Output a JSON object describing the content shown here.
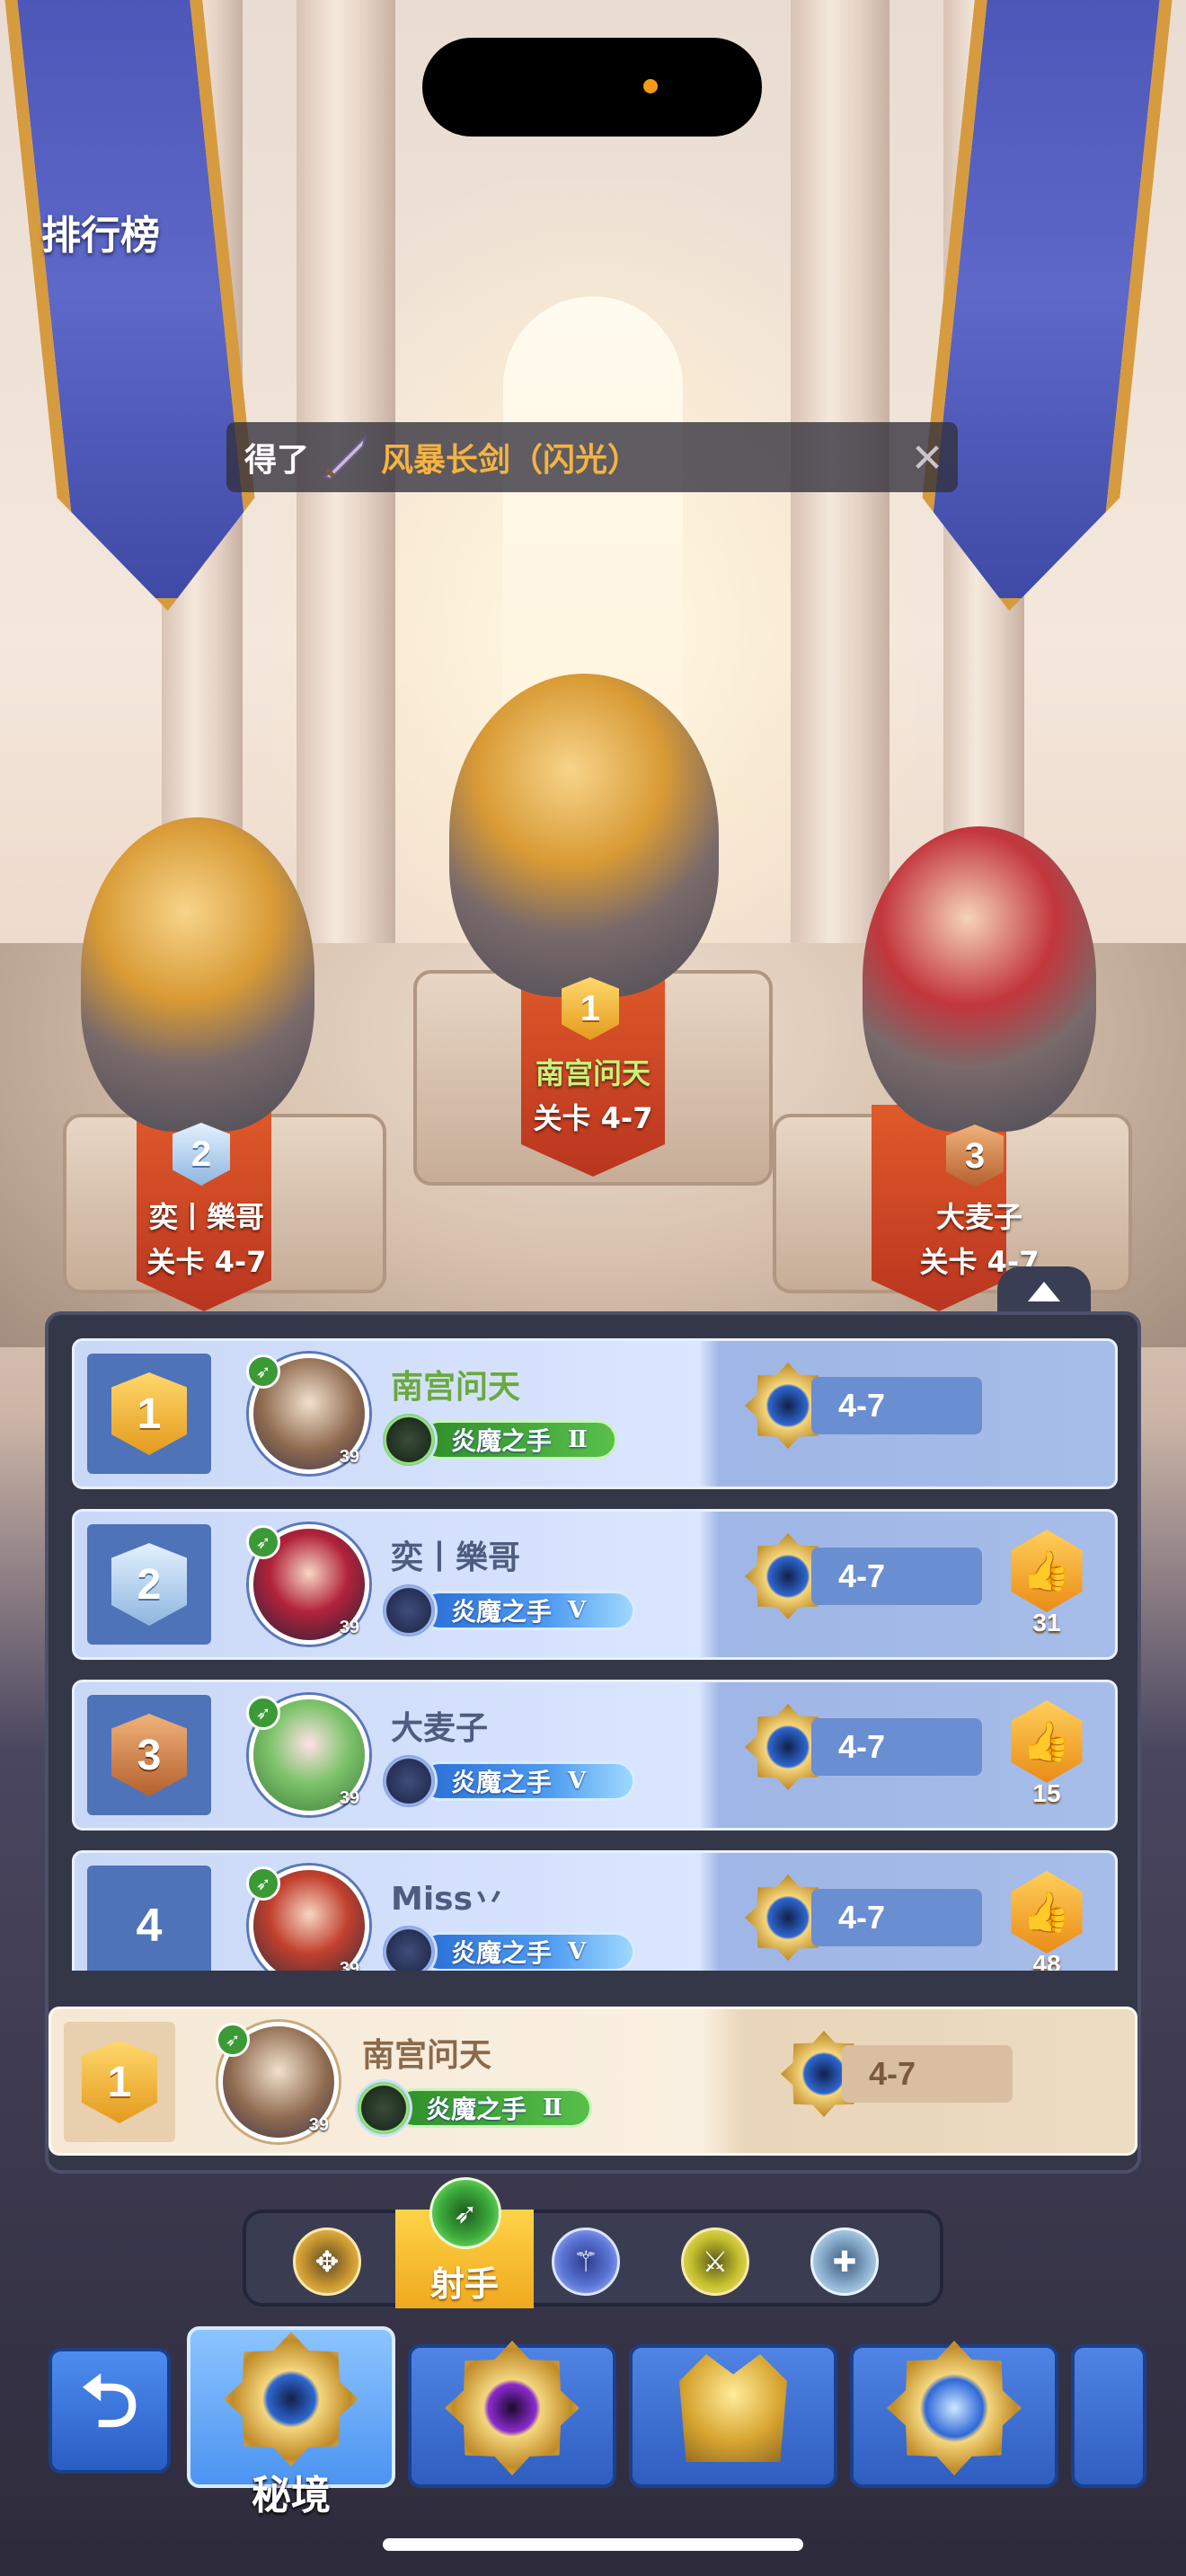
{
  "status": {
    "recording_dot_color": "#f39a16"
  },
  "header": {
    "title": "排行榜"
  },
  "toast": {
    "prefix": "得了",
    "item_icon": "sword-icon",
    "item_name": "风暴长剑（闪光）",
    "close_icon": "close-icon"
  },
  "podium": [
    {
      "rank": "2",
      "name": "奕丨樂哥",
      "stage": "关卡 4-7",
      "badge_color": "silver"
    },
    {
      "rank": "1",
      "name": "南宫问天",
      "stage": "关卡 4-7",
      "badge_color": "gold"
    },
    {
      "rank": "3",
      "name": "大麦子",
      "stage": "关卡 4-7",
      "badge_color": "bronze"
    }
  ],
  "leaderboard": {
    "rows": [
      {
        "rank": "1",
        "name": "南宫问天",
        "level": "39",
        "title": "炎魔之手",
        "tier": "Ⅱ",
        "stage": "4-7",
        "likes": null
      },
      {
        "rank": "2",
        "name": "奕丨樂哥",
        "level": "39",
        "title": "炎魔之手",
        "tier": "Ⅴ",
        "stage": "4-7",
        "likes": "31"
      },
      {
        "rank": "3",
        "name": "大麦子",
        "level": "39",
        "title": "炎魔之手",
        "tier": "Ⅴ",
        "stage": "4-7",
        "likes": "15"
      },
      {
        "rank": "4",
        "name": "Miss丷",
        "level": "39",
        "title": "炎魔之手",
        "tier": "Ⅴ",
        "stage": "4-7",
        "likes": "48"
      }
    ],
    "self": {
      "rank": "1",
      "name": "南宫问天",
      "level": "39",
      "title": "炎魔之手",
      "tier": "Ⅱ",
      "stage": "4-7"
    }
  },
  "class_tabs": {
    "items": [
      "axe-class-icon",
      "bow-class-icon",
      "staff-class-icon",
      "blade-class-icon",
      "cross-class-icon"
    ],
    "active_label": "射手"
  },
  "modes": {
    "back_icon": "back-arrow-icon",
    "items": [
      {
        "label": "秘境",
        "icon": "secret-realm-emblem-icon",
        "active": true
      },
      {
        "label": "",
        "icon": "purple-gem-emblem-icon",
        "active": false
      },
      {
        "label": "",
        "icon": "crown-emblem-icon",
        "active": false
      },
      {
        "label": "",
        "icon": "star-emblem-icon",
        "active": false
      }
    ]
  },
  "colors": {
    "gold": "#e49a1d",
    "name_first": "#6aa93e",
    "row_bg": "#c9d8f7",
    "self_row_bg": "#f5e9d6",
    "tab_active": "#ffd347"
  }
}
